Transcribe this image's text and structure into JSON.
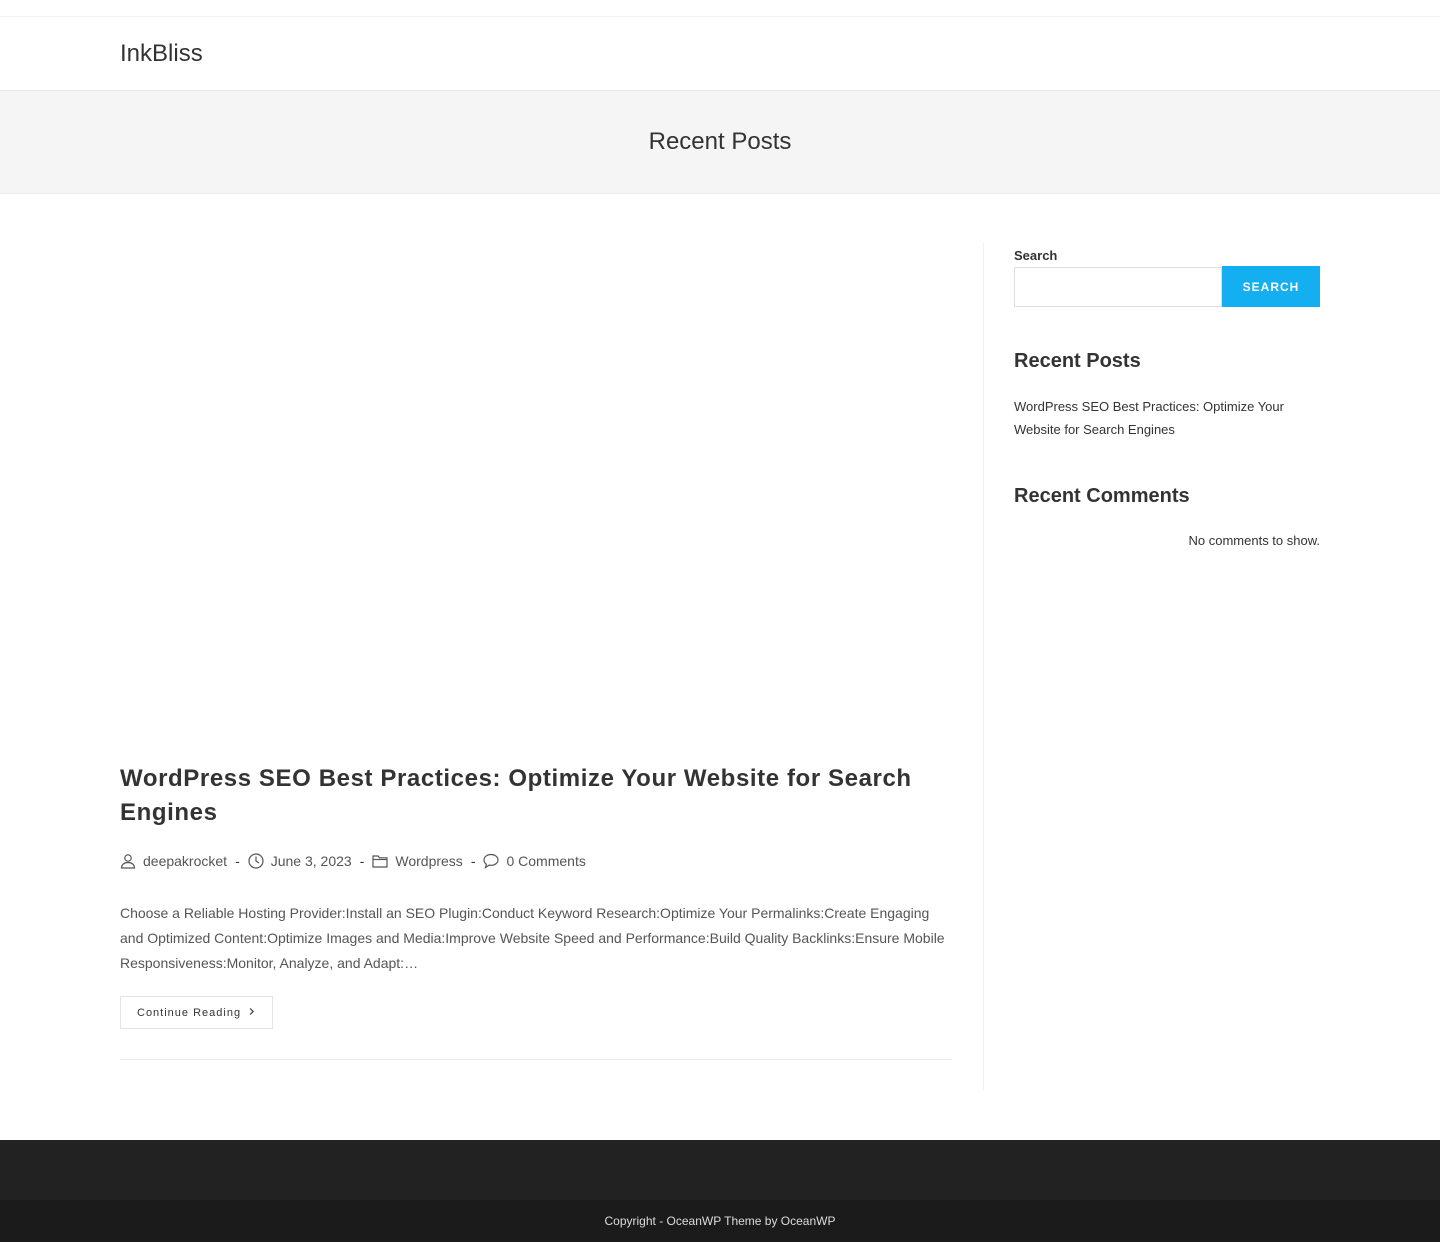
{
  "site": {
    "name": "InkBliss"
  },
  "page": {
    "title": "Recent Posts"
  },
  "post": {
    "title": "WordPress SEO Best Practices: Optimize Your Website for Search Engines",
    "author": "deepakrocket",
    "date": "June 3, 2023",
    "category": "Wordpress",
    "comments": "0 Comments",
    "separator": "-",
    "excerpt": "Choose a Reliable Hosting Provider:Install an SEO Plugin:Conduct Keyword Research:Optimize Your Permalinks:Create Engaging and Optimized Content:Optimize Images and Media:Improve Website Speed and Performance:Build Quality Backlinks:Ensure Mobile Responsiveness:Monitor, Analyze, and Adapt:…",
    "continue_label": "Continue Reading",
    "icons": {
      "author": "user-icon",
      "date": "clock-icon",
      "category": "folder-icon",
      "comments": "comment-icon",
      "continue": "chevron-right-icon"
    }
  },
  "sidebar": {
    "search": {
      "label": "Search",
      "placeholder": "",
      "value": "",
      "button_label": "SEARCH"
    },
    "recent_posts": {
      "title": "Recent Posts",
      "items": [
        "WordPress SEO Best Practices: Optimize Your Website for Search Engines"
      ]
    },
    "recent_comments": {
      "title": "Recent Comments",
      "empty_text": "No comments to show."
    }
  },
  "footer": {
    "copyright": "Copyright - OceanWP Theme by OceanWP"
  },
  "colors": {
    "accent": "#13aff0",
    "text": "#333333",
    "meta": "#555555",
    "footer_top": "#222222",
    "footer_bottom": "#1b1b1b",
    "page_header_bg": "#f5f5f5"
  }
}
